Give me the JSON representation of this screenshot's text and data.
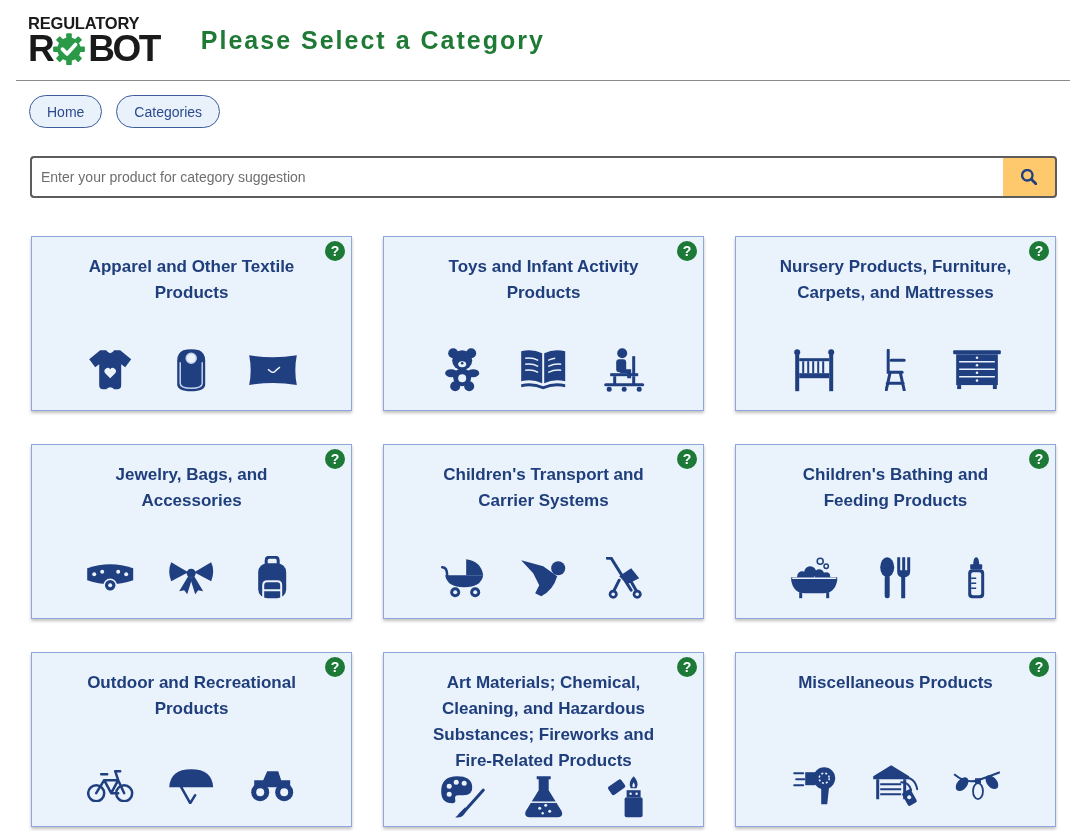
{
  "logo": {
    "line_1": "REGULATORY",
    "line_2_start": "R",
    "line_2_end": "BOT"
  },
  "page_title": "Please Select a Category",
  "nav": [
    {
      "label": "Home"
    },
    {
      "label": "Categories"
    }
  ],
  "search": {
    "placeholder": "Enter your product for category suggestion"
  },
  "categories": [
    {
      "kind": "apparel",
      "title": "Apparel and Other Textile Products",
      "help": "?"
    },
    {
      "kind": "toys",
      "title": "Toys and Infant Activity Products",
      "help": "?"
    },
    {
      "kind": "nursery",
      "title": "Nursery Products, Furniture, Carpets, and Mattresses",
      "help": "?"
    },
    {
      "kind": "jewelry",
      "title": "Jewelry, Bags, and Accessories",
      "help": "?"
    },
    {
      "kind": "transport",
      "title": "Children's Transport and Carrier Systems",
      "help": "?"
    },
    {
      "kind": "bathing",
      "title": "Children's Bathing and Feeding Products",
      "help": "?"
    },
    {
      "kind": "outdoor",
      "title": "Outdoor and Recreational Products",
      "help": "?"
    },
    {
      "kind": "art",
      "title": "Art Materials; Chemical, Cleaning, and Hazardous Substances; Fireworks and Fire-Related Products",
      "help": "?"
    },
    {
      "kind": "misc",
      "title": "Miscellaneous Products",
      "help": "?"
    }
  ]
}
